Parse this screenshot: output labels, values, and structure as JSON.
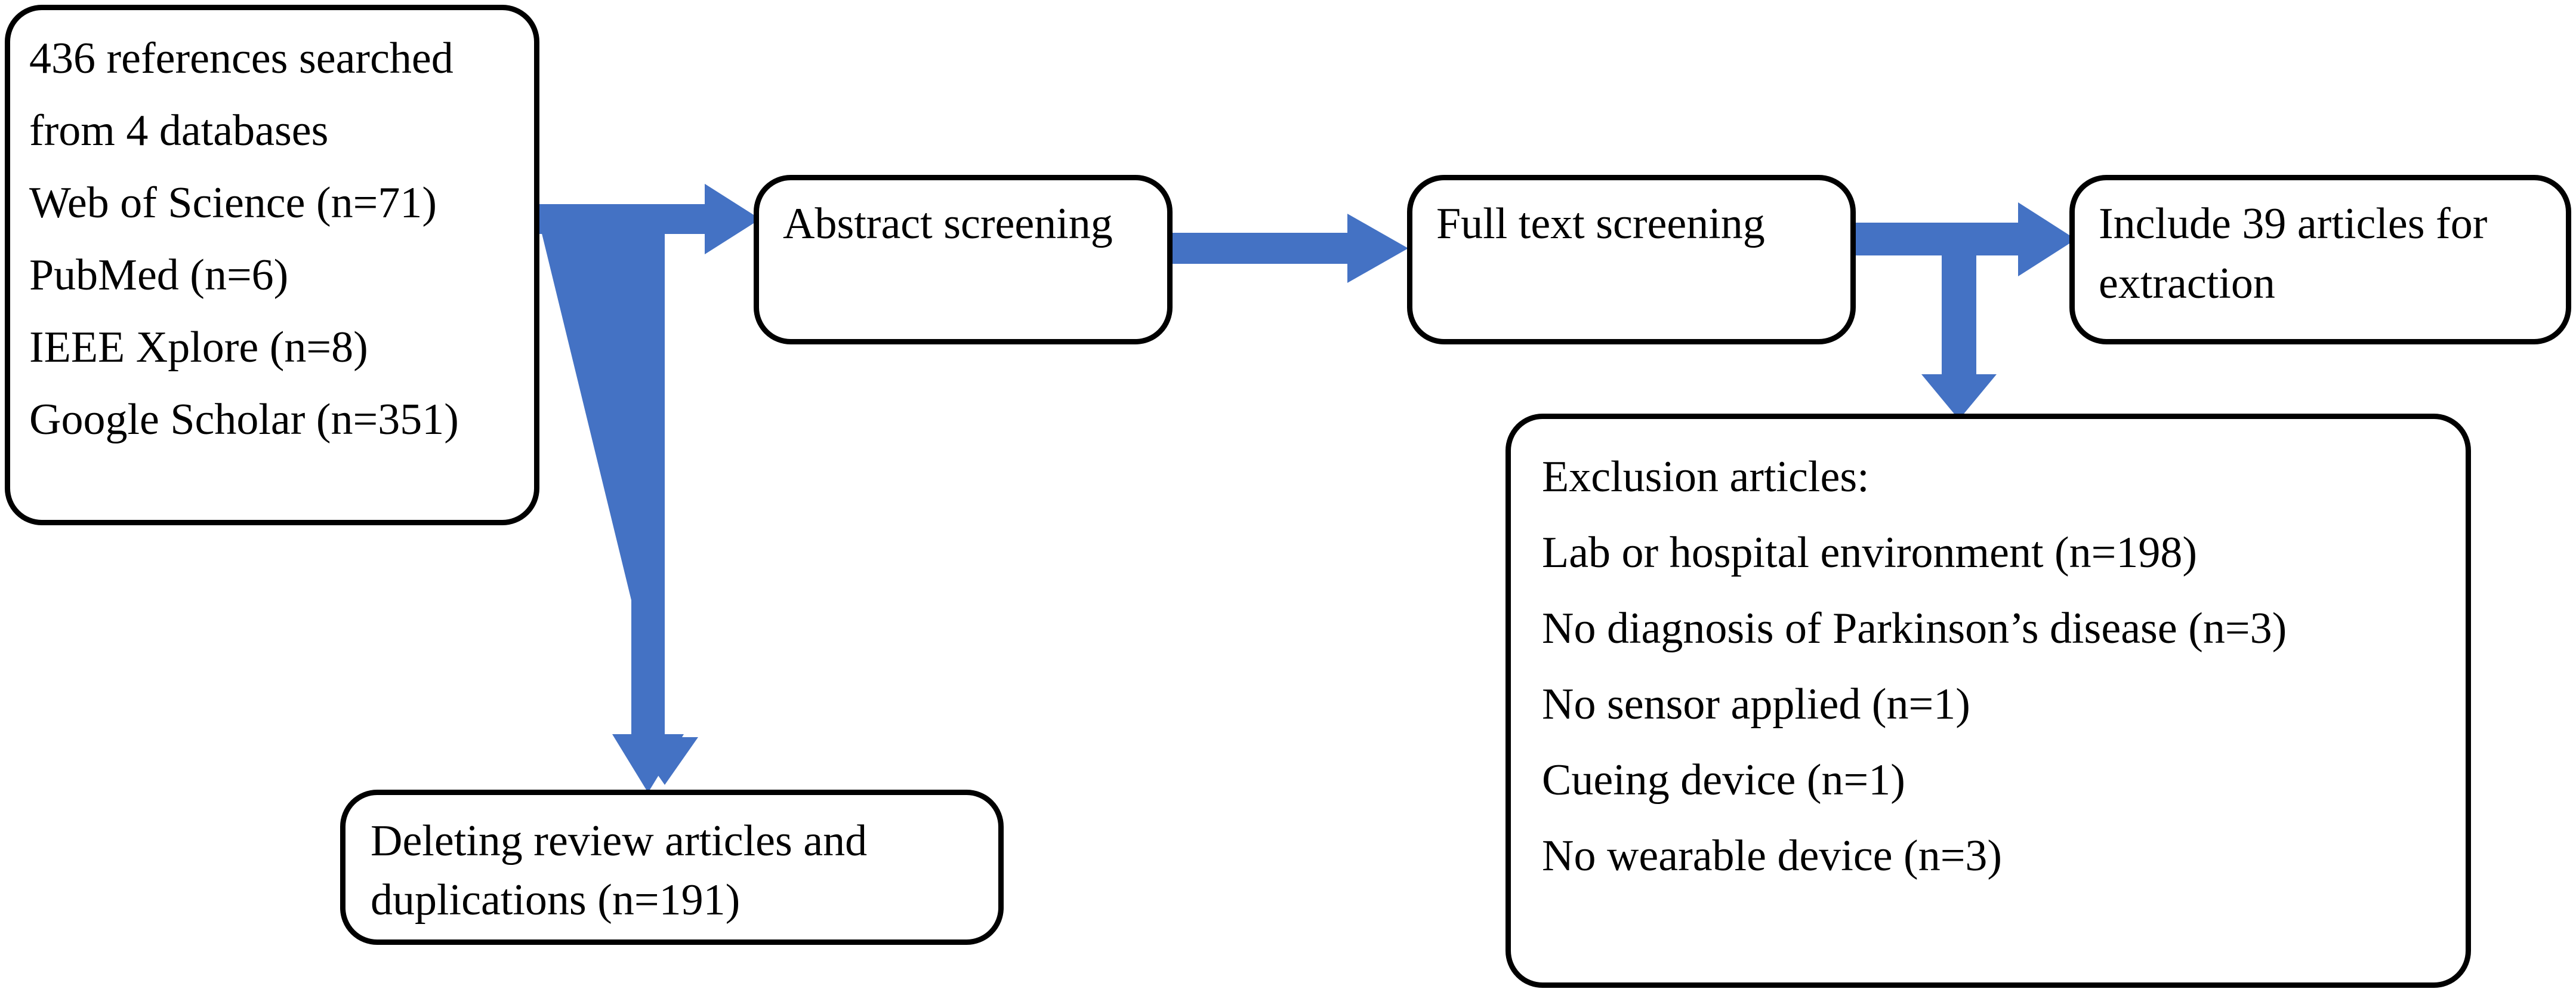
{
  "diagram": {
    "title": "Literature search and screening flow diagram",
    "accent_color": "#4472C4",
    "stroke_color": "#000000",
    "background_color": "#FFFFFF"
  },
  "boxes": {
    "sources": {
      "name": "search-sources",
      "lines": [
        "436 references searched",
        "from 4 databases",
        "Web of Science (n=71)",
        " PubMed (n=6)",
        "IEEE Xplore (n=8)",
        "Google Scholar (n=351)"
      ]
    },
    "abstract_screening": {
      "name": "abstract-screening",
      "lines": [
        "Abstract screening"
      ]
    },
    "full_text_screening": {
      "name": "full-text-screening",
      "lines": [
        "Full text screening"
      ]
    },
    "include": {
      "name": "include-articles",
      "lines": [
        "Include 39 articles for",
        "extraction"
      ]
    },
    "deleting": {
      "name": "deleting-review-articles",
      "lines": [
        "Deleting review articles and",
        "duplications (n=191)"
      ]
    },
    "exclusion": {
      "name": "exclusion-articles",
      "lines": [
        "Exclusion articles:",
        "Lab or hospital environment (n=198)",
        "No diagnosis of Parkinson’s disease (n=3)",
        "No sensor applied  (n=1)",
        "Cueing device  (n=1)",
        "No wearable device (n=3)"
      ]
    }
  },
  "arrows": {
    "sources_to_abstract": {
      "name": "arrow-sources-to-abstract",
      "shape": "tee-right-and-down",
      "from": "search-sources",
      "to": [
        "abstract-screening",
        "deleting-review-articles"
      ]
    },
    "abstract_to_fulltext": {
      "name": "arrow-abstract-to-fulltext",
      "shape": "right",
      "from": "abstract-screening",
      "to": [
        "full-text-screening"
      ]
    },
    "fulltext_to_include": {
      "name": "arrow-fulltext-to-include",
      "shape": "tee-right-and-down",
      "from": "full-text-screening",
      "to": [
        "include-articles",
        "exclusion-articles"
      ]
    }
  }
}
